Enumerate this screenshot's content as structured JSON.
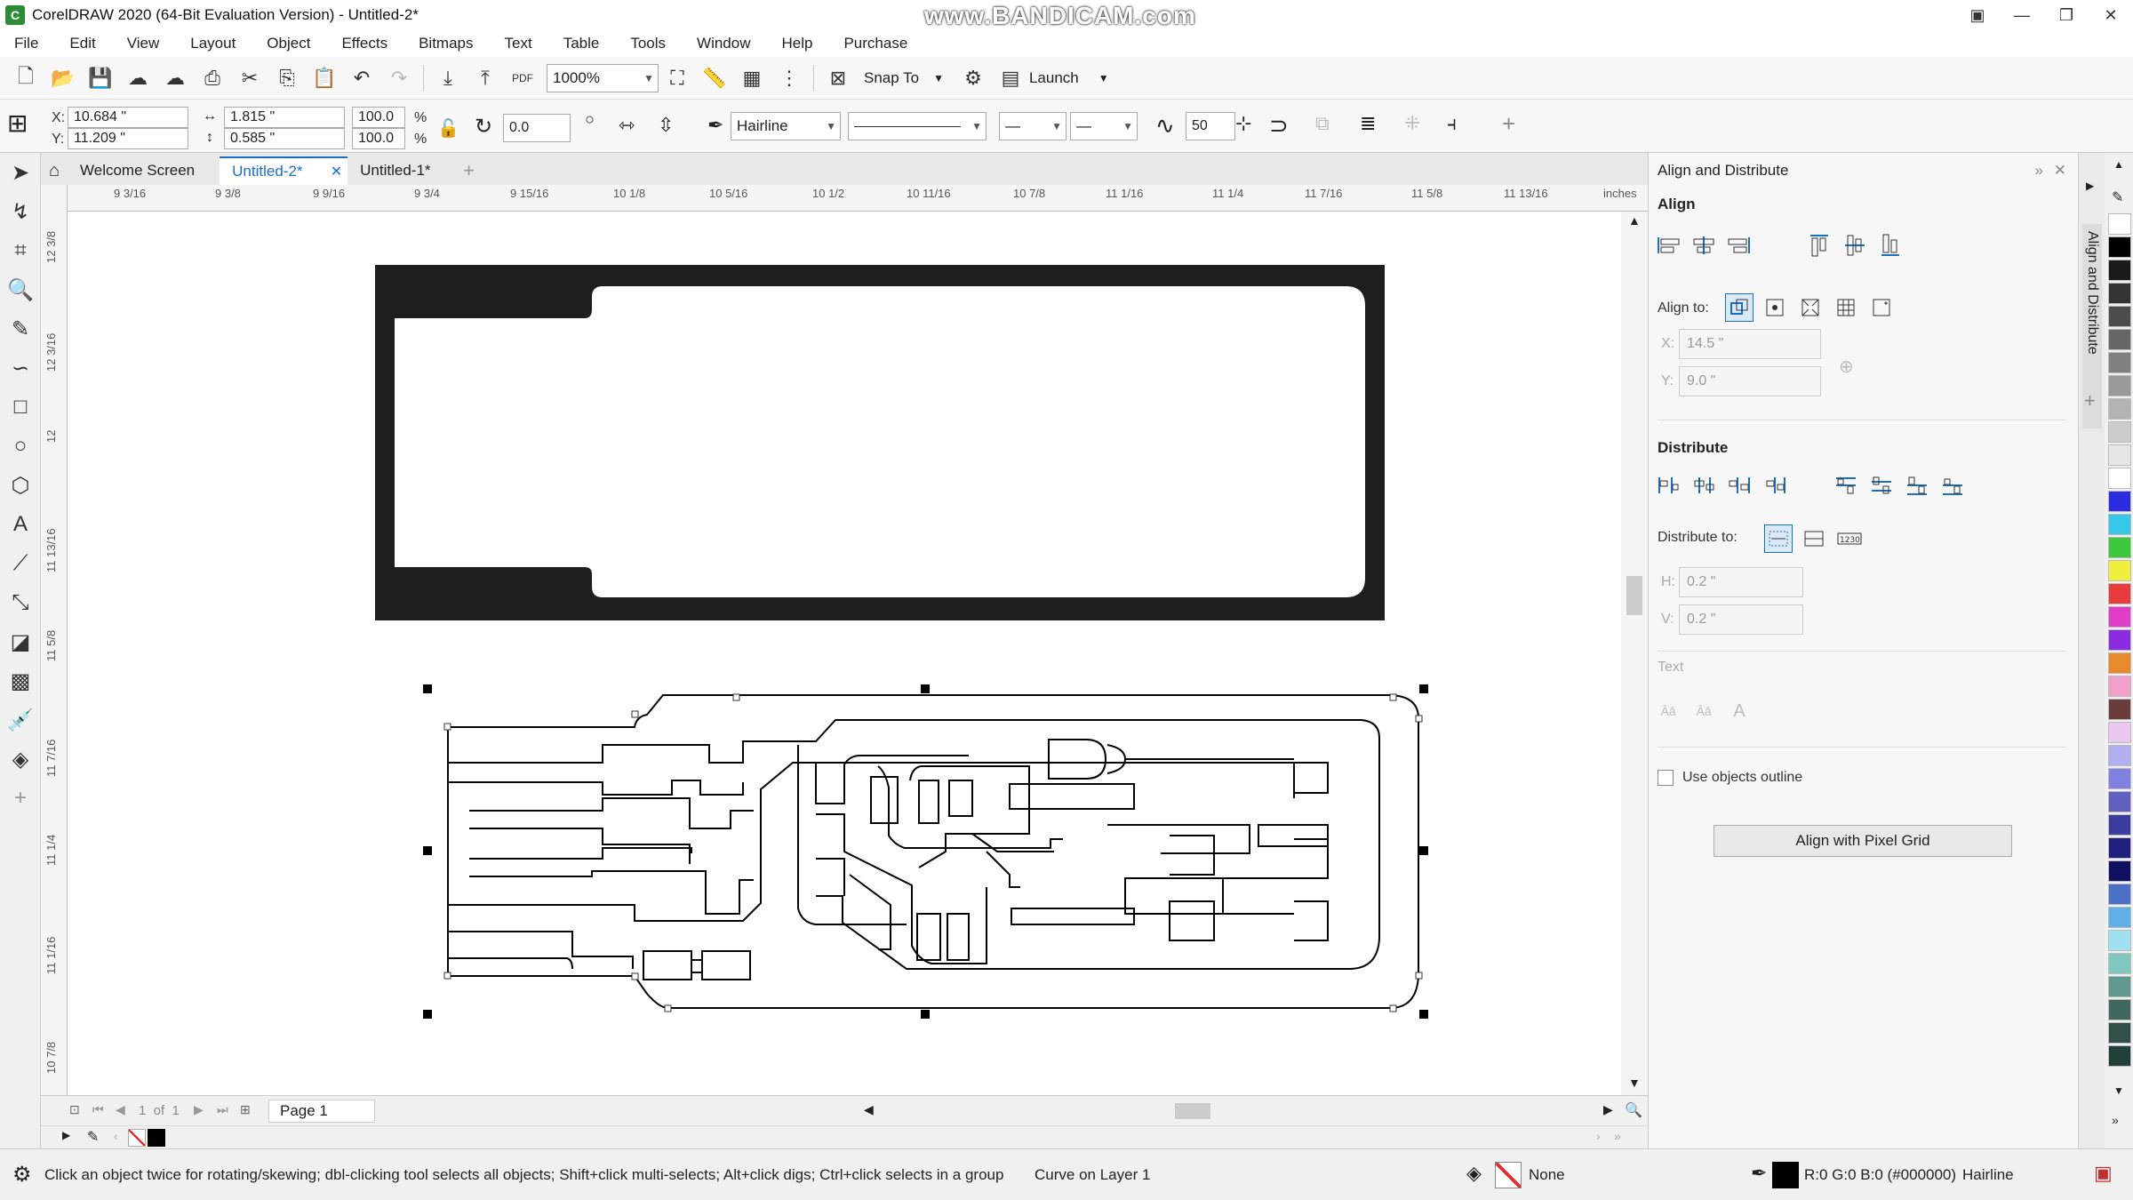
{
  "titlebar": {
    "title": "CorelDRAW 2020 (64-Bit Evaluation Version) - Untitled-2*",
    "watermark": "www.BANDICAM.com"
  },
  "menu": [
    "File",
    "Edit",
    "View",
    "Layout",
    "Object",
    "Effects",
    "Bitmaps",
    "Text",
    "Table",
    "Tools",
    "Window",
    "Help",
    "Purchase"
  ],
  "toolbar": {
    "zoom": "1000%",
    "snap_to": "Snap To",
    "launch": "Launch"
  },
  "propbar": {
    "x_label": "X:",
    "x_value": "10.684 \"",
    "y_label": "Y:",
    "y_value": "11.209 \"",
    "w_value": "1.815 \"",
    "h_value": "0.585 \"",
    "scale_w": "100.0",
    "scale_h": "100.0",
    "pct1": "%",
    "pct2": "%",
    "angle": "0.0",
    "outline_width": "Hairline",
    "smoothing": "50"
  },
  "tabs": [
    {
      "label": "Welcome Screen",
      "active": false
    },
    {
      "label": "Untitled-2*",
      "active": true
    },
    {
      "label": "Untitled-1*",
      "active": false
    }
  ],
  "ruler_h": [
    "9 3/16",
    "9 3/8",
    "9 9/16",
    "9 3/4",
    "9 15/16",
    "10 1/8",
    "10 5/16",
    "10 1/2",
    "10 11/16",
    "10 7/8",
    "11 1/16",
    "11 1/4",
    "11 7/16",
    "11 5/8",
    "11 13/16",
    "inches"
  ],
  "ruler_v": [
    "12 3/8",
    "12 3/16",
    "12",
    "11 13/16",
    "11 5/8",
    "11 7/16",
    "11 1/4",
    "11 1/16",
    "10 7/8"
  ],
  "pagenav": {
    "page_of": "1  of  1",
    "page_tab": "Page 1"
  },
  "docker": {
    "title": "Align and Distribute",
    "align_section": "Align",
    "align_to_label": "Align to:",
    "x_label": "X:",
    "x_value": "14.5 \"",
    "y_label": "Y:",
    "y_value": "9.0 \"",
    "distribute_section": "Distribute",
    "distribute_to_label": "Distribute to:",
    "h_label": "H:",
    "h_value": "0.2 \"",
    "v_label": "V:",
    "v_value": "0.2 \"",
    "text_section": "Text",
    "use_outline_label": "Use objects outline",
    "pixel_grid_button": "Align with Pixel Grid",
    "vertical_tab": "Align and Distribute"
  },
  "status": {
    "hint": "Click an object twice for rotating/skewing; dbl-clicking tool selects all objects; Shift+click multi-selects; Alt+click digs; Ctrl+click selects in a group",
    "object": "Curve on Layer 1",
    "fill": "None",
    "color": "R:0 G:0 B:0 (#000000)",
    "outline": "Hairline"
  },
  "palette_colors": [
    "#ffffff",
    "#000000",
    "#1a1a1a",
    "#333333",
    "#4d4d4d",
    "#666666",
    "#808080",
    "#999999",
    "#b3b3b3",
    "#cccccc",
    "#e6e6e6",
    "#ffffff",
    "#2b2be0",
    "#36c8e8",
    "#3cc93c",
    "#f0f03c",
    "#e83c3c",
    "#e03cc8",
    "#8a2be2",
    "#e88a2b",
    "#f0a0c8",
    "#6b3c3c",
    "#e8c8f0",
    "#b0b0f0",
    "#8080e0",
    "#6060c0",
    "#3c3ca0",
    "#202080",
    "#101060",
    "#4a70c8",
    "#60b0e8",
    "#a0e0f0",
    "#80c8c0",
    "#609890",
    "#406860",
    "#305048",
    "#204038"
  ]
}
